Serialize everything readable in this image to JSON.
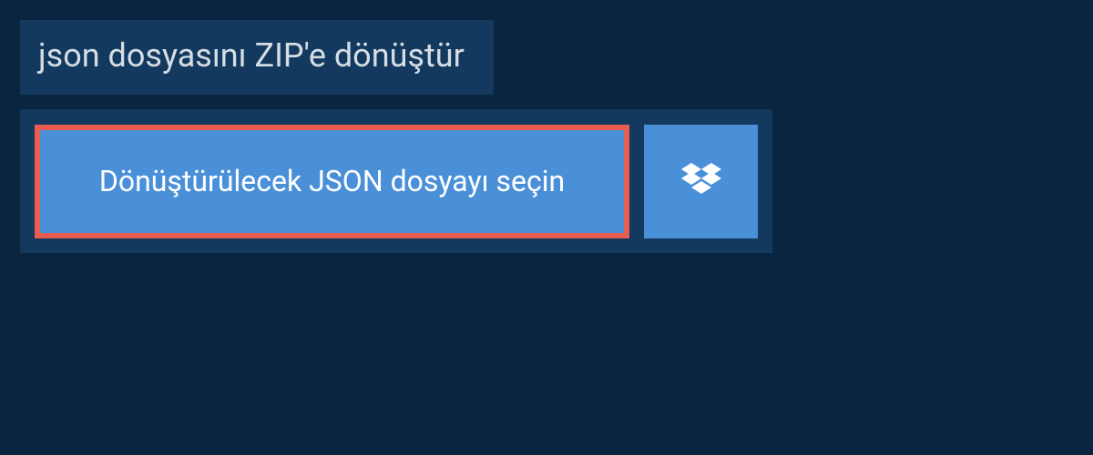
{
  "header": {
    "title": "json dosyasını ZIP'e dönüştür"
  },
  "actions": {
    "select_file_label": "Dönüştürülecek JSON dosyayı seçin",
    "dropbox_icon_name": "dropbox-icon"
  },
  "colors": {
    "background": "#0a2540",
    "panel": "#133a5e",
    "button": "#4a90d9",
    "highlight_border": "#e85d4f",
    "text_light": "#d5dde5",
    "text_white": "#ffffff"
  }
}
